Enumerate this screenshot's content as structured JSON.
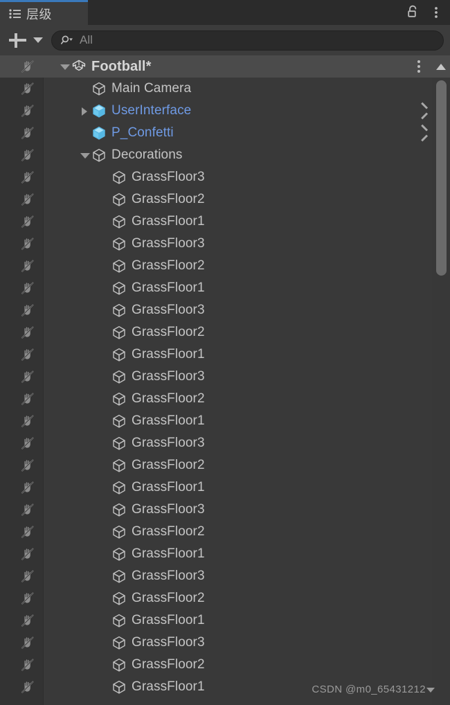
{
  "window": {
    "tab_label": "层级",
    "tab_icon": "hierarchy-list-icon",
    "lock_icon": "unlock-icon",
    "menu_icon": "kebab-menu-icon"
  },
  "toolbar": {
    "add_label": "+",
    "add_icon": "plus-icon",
    "add_dropdown_icon": "caret-down-icon",
    "search_icon": "search-dropdown-icon",
    "search_value": "",
    "search_placeholder": "All"
  },
  "scrollbar": {
    "up_arrow_icon": "scroll-up-arrow-icon",
    "thumb_icon": "scroll-thumb"
  },
  "colors": {
    "panel_bg": "#393939",
    "tab_bg": "#3c3c3c",
    "tabbar_bg": "#2b2b2b",
    "active_tab_accent": "#3a79bb",
    "row_selected_bg": "#4b4b4b",
    "gutter_bg": "#333333",
    "text": "#c4c4c4",
    "prefab_text": "#6f9ae4",
    "prefab_icon": "#7ed0f2",
    "scroll_thumb": "#6b6b6b"
  },
  "hierarchy": {
    "rows": [
      {
        "label": "Football*",
        "depth": 0,
        "icon": "unity-scene-icon",
        "twisty": "down",
        "selected": true,
        "bold": true,
        "prefab": false,
        "menu": true,
        "chevron": false,
        "vis_icon": "pick-disabled-icon"
      },
      {
        "label": "Main Camera",
        "depth": 1,
        "icon": "gameobject-cube-icon",
        "twisty": "none",
        "selected": false,
        "bold": false,
        "prefab": false,
        "menu": false,
        "chevron": false,
        "vis_icon": "pick-disabled-icon"
      },
      {
        "label": "UserInterface",
        "depth": 1,
        "icon": "prefab-cube-icon",
        "twisty": "right",
        "selected": false,
        "bold": false,
        "prefab": true,
        "menu": false,
        "chevron": true,
        "vis_icon": "pick-disabled-icon"
      },
      {
        "label": "P_Confetti",
        "depth": 1,
        "icon": "prefab-cube-icon",
        "twisty": "none",
        "selected": false,
        "bold": false,
        "prefab": true,
        "menu": false,
        "chevron": true,
        "vis_icon": "pick-disabled-icon"
      },
      {
        "label": "Decorations",
        "depth": 1,
        "icon": "gameobject-cube-icon",
        "twisty": "down",
        "selected": false,
        "bold": false,
        "prefab": false,
        "menu": false,
        "chevron": false,
        "vis_icon": "pick-disabled-icon"
      },
      {
        "label": "GrassFloor3",
        "depth": 2,
        "icon": "gameobject-cube-icon",
        "twisty": "none",
        "selected": false,
        "bold": false,
        "prefab": false,
        "menu": false,
        "chevron": false,
        "vis_icon": "pick-disabled-icon"
      },
      {
        "label": "GrassFloor2",
        "depth": 2,
        "icon": "gameobject-cube-icon",
        "twisty": "none",
        "selected": false,
        "bold": false,
        "prefab": false,
        "menu": false,
        "chevron": false,
        "vis_icon": "pick-disabled-icon"
      },
      {
        "label": "GrassFloor1",
        "depth": 2,
        "icon": "gameobject-cube-icon",
        "twisty": "none",
        "selected": false,
        "bold": false,
        "prefab": false,
        "menu": false,
        "chevron": false,
        "vis_icon": "pick-disabled-icon"
      },
      {
        "label": "GrassFloor3",
        "depth": 2,
        "icon": "gameobject-cube-icon",
        "twisty": "none",
        "selected": false,
        "bold": false,
        "prefab": false,
        "menu": false,
        "chevron": false,
        "vis_icon": "pick-disabled-icon"
      },
      {
        "label": "GrassFloor2",
        "depth": 2,
        "icon": "gameobject-cube-icon",
        "twisty": "none",
        "selected": false,
        "bold": false,
        "prefab": false,
        "menu": false,
        "chevron": false,
        "vis_icon": "pick-disabled-icon"
      },
      {
        "label": "GrassFloor1",
        "depth": 2,
        "icon": "gameobject-cube-icon",
        "twisty": "none",
        "selected": false,
        "bold": false,
        "prefab": false,
        "menu": false,
        "chevron": false,
        "vis_icon": "pick-disabled-icon"
      },
      {
        "label": "GrassFloor3",
        "depth": 2,
        "icon": "gameobject-cube-icon",
        "twisty": "none",
        "selected": false,
        "bold": false,
        "prefab": false,
        "menu": false,
        "chevron": false,
        "vis_icon": "pick-disabled-icon"
      },
      {
        "label": "GrassFloor2",
        "depth": 2,
        "icon": "gameobject-cube-icon",
        "twisty": "none",
        "selected": false,
        "bold": false,
        "prefab": false,
        "menu": false,
        "chevron": false,
        "vis_icon": "pick-disabled-icon"
      },
      {
        "label": "GrassFloor1",
        "depth": 2,
        "icon": "gameobject-cube-icon",
        "twisty": "none",
        "selected": false,
        "bold": false,
        "prefab": false,
        "menu": false,
        "chevron": false,
        "vis_icon": "pick-disabled-icon"
      },
      {
        "label": "GrassFloor3",
        "depth": 2,
        "icon": "gameobject-cube-icon",
        "twisty": "none",
        "selected": false,
        "bold": false,
        "prefab": false,
        "menu": false,
        "chevron": false,
        "vis_icon": "pick-disabled-icon"
      },
      {
        "label": "GrassFloor2",
        "depth": 2,
        "icon": "gameobject-cube-icon",
        "twisty": "none",
        "selected": false,
        "bold": false,
        "prefab": false,
        "menu": false,
        "chevron": false,
        "vis_icon": "pick-disabled-icon"
      },
      {
        "label": "GrassFloor1",
        "depth": 2,
        "icon": "gameobject-cube-icon",
        "twisty": "none",
        "selected": false,
        "bold": false,
        "prefab": false,
        "menu": false,
        "chevron": false,
        "vis_icon": "pick-disabled-icon"
      },
      {
        "label": "GrassFloor3",
        "depth": 2,
        "icon": "gameobject-cube-icon",
        "twisty": "none",
        "selected": false,
        "bold": false,
        "prefab": false,
        "menu": false,
        "chevron": false,
        "vis_icon": "pick-disabled-icon"
      },
      {
        "label": "GrassFloor2",
        "depth": 2,
        "icon": "gameobject-cube-icon",
        "twisty": "none",
        "selected": false,
        "bold": false,
        "prefab": false,
        "menu": false,
        "chevron": false,
        "vis_icon": "pick-disabled-icon"
      },
      {
        "label": "GrassFloor1",
        "depth": 2,
        "icon": "gameobject-cube-icon",
        "twisty": "none",
        "selected": false,
        "bold": false,
        "prefab": false,
        "menu": false,
        "chevron": false,
        "vis_icon": "pick-disabled-icon"
      },
      {
        "label": "GrassFloor3",
        "depth": 2,
        "icon": "gameobject-cube-icon",
        "twisty": "none",
        "selected": false,
        "bold": false,
        "prefab": false,
        "menu": false,
        "chevron": false,
        "vis_icon": "pick-disabled-icon"
      },
      {
        "label": "GrassFloor2",
        "depth": 2,
        "icon": "gameobject-cube-icon",
        "twisty": "none",
        "selected": false,
        "bold": false,
        "prefab": false,
        "menu": false,
        "chevron": false,
        "vis_icon": "pick-disabled-icon"
      },
      {
        "label": "GrassFloor1",
        "depth": 2,
        "icon": "gameobject-cube-icon",
        "twisty": "none",
        "selected": false,
        "bold": false,
        "prefab": false,
        "menu": false,
        "chevron": false,
        "vis_icon": "pick-disabled-icon"
      },
      {
        "label": "GrassFloor3",
        "depth": 2,
        "icon": "gameobject-cube-icon",
        "twisty": "none",
        "selected": false,
        "bold": false,
        "prefab": false,
        "menu": false,
        "chevron": false,
        "vis_icon": "pick-disabled-icon"
      },
      {
        "label": "GrassFloor2",
        "depth": 2,
        "icon": "gameobject-cube-icon",
        "twisty": "none",
        "selected": false,
        "bold": false,
        "prefab": false,
        "menu": false,
        "chevron": false,
        "vis_icon": "pick-disabled-icon"
      },
      {
        "label": "GrassFloor1",
        "depth": 2,
        "icon": "gameobject-cube-icon",
        "twisty": "none",
        "selected": false,
        "bold": false,
        "prefab": false,
        "menu": false,
        "chevron": false,
        "vis_icon": "pick-disabled-icon"
      },
      {
        "label": "GrassFloor3",
        "depth": 2,
        "icon": "gameobject-cube-icon",
        "twisty": "none",
        "selected": false,
        "bold": false,
        "prefab": false,
        "menu": false,
        "chevron": false,
        "vis_icon": "pick-disabled-icon"
      },
      {
        "label": "GrassFloor2",
        "depth": 2,
        "icon": "gameobject-cube-icon",
        "twisty": "none",
        "selected": false,
        "bold": false,
        "prefab": false,
        "menu": false,
        "chevron": false,
        "vis_icon": "pick-disabled-icon"
      },
      {
        "label": "GrassFloor1",
        "depth": 2,
        "icon": "gameobject-cube-icon",
        "twisty": "none",
        "selected": false,
        "bold": false,
        "prefab": false,
        "menu": false,
        "chevron": false,
        "vis_icon": "pick-disabled-icon"
      }
    ]
  },
  "watermark": {
    "text": "CSDN @m0_65431212"
  }
}
